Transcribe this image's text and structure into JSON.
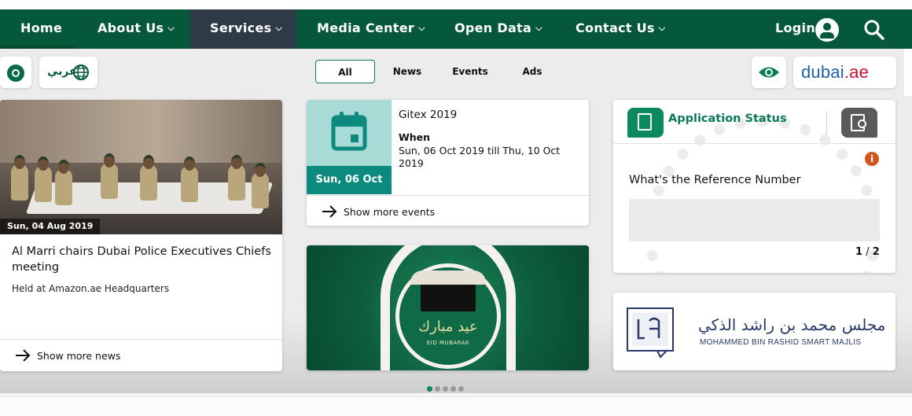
{
  "nav": {
    "home": "Home",
    "about": "About Us",
    "services": "Services",
    "media": "Media Center",
    "open_data": "Open Data",
    "contact": "Contact Us",
    "login": "Login"
  },
  "language_toggle": "عربي",
  "dubai_logo": {
    "main": "dubai",
    "suffix": ".ae"
  },
  "filter_tabs": [
    "All",
    "News",
    "Events",
    "Ads"
  ],
  "news": {
    "date": "Sun, 04 Aug 2019",
    "title": "Al Marri chairs Dubai Police Executives Chiefs meeting",
    "description": "Held at Amazon.ae Headquarters",
    "more": "Show more news"
  },
  "event": {
    "title": "Gitex 2019",
    "when_label": "When",
    "dates": "Sun, 06 Oct 2019 till Thu, 10 Oct 2019",
    "date_badge": "Sun, 06 Oct",
    "more": "Show more events"
  },
  "banner": {
    "calligraphy": "عيد مبارك",
    "caption": "EID MUBARAK"
  },
  "carousel": {
    "total": 5,
    "active": 1
  },
  "application_status": {
    "title": "Application Status",
    "info": "i",
    "question": "What's the Reference Number",
    "input_value": "",
    "page_current": "1",
    "page_separator": "/",
    "page_total": "2"
  },
  "majlis": {
    "arabic": "مجلس محمد بن راشد الذكي",
    "english": "MOHAMMED BIN RASHID SMART MAJLIS"
  },
  "colors": {
    "nav_bg": "#05593a",
    "active_nav": "#2e3a45",
    "accent": "#0b8a7d",
    "app_green": "#0b8a5e",
    "info_orange": "#d2541a"
  }
}
